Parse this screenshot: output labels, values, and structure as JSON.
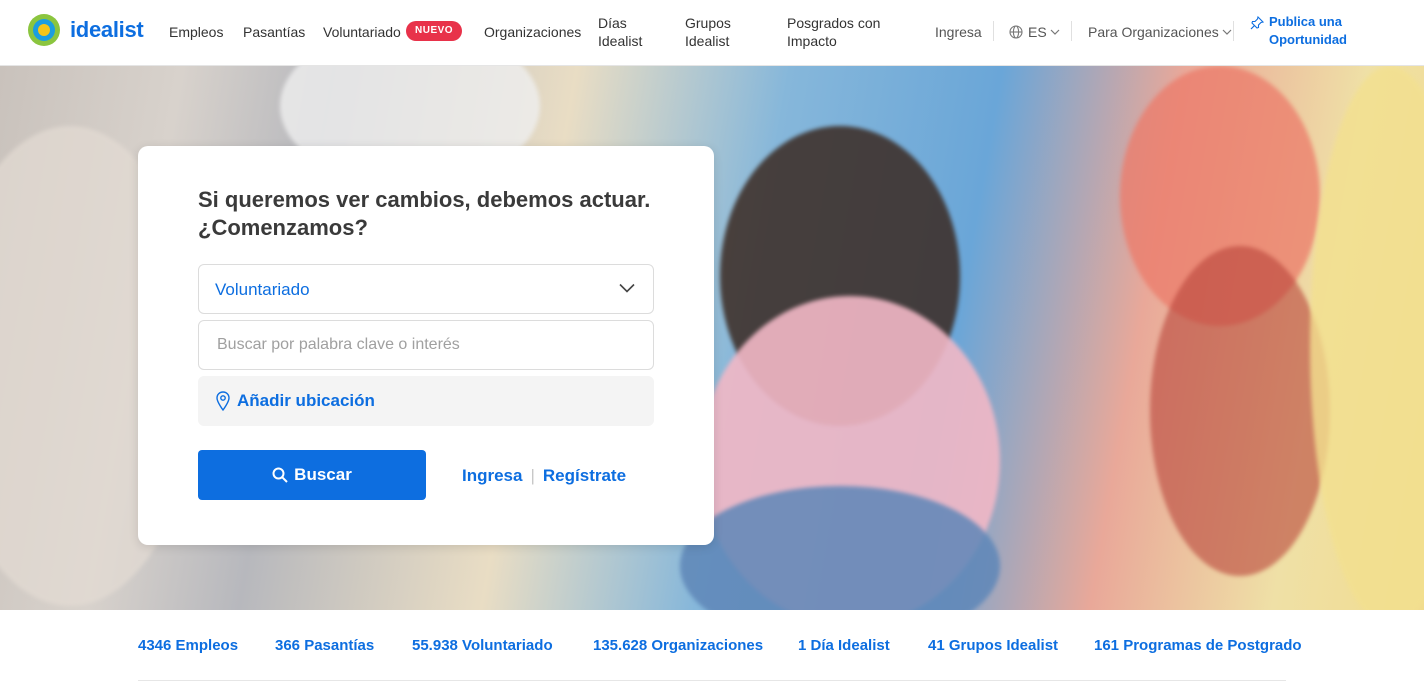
{
  "header": {
    "brand": "idealist",
    "nav": {
      "empleos": "Empleos",
      "pasantias": "Pasantías",
      "voluntariado": "Voluntariado",
      "nuevo_badge": "NUEVO",
      "organizaciones": "Organizaciones",
      "dias_line1": "Días",
      "dias_line2": "Idealist",
      "grupos_line1": "Grupos",
      "grupos_line2": "Idealist",
      "posgrados_line1": "Posgrados con",
      "posgrados_line2": "Impacto"
    },
    "ingresa": "Ingresa",
    "language": "ES",
    "para_org": "Para Organizaciones",
    "publish_line1": "Publica una",
    "publish_line2": "Oportunidad"
  },
  "search_card": {
    "title_line1": "Si queremos ver cambios, debemos actuar.",
    "title_line2": "¿Comenzamos?",
    "category_selected": "Voluntariado",
    "keyword_placeholder": "Buscar por palabra clave o interés",
    "location_label": "Añadir ubicación",
    "search_button": "Buscar",
    "login_link": "Ingresa",
    "register_link": "Regístrate"
  },
  "stats": [
    "4346 Empleos",
    "366 Pasantías",
    "55.938 Voluntariado",
    "135.628 Organizaciones",
    "1 Día Idealist",
    "41 Grupos Idealist",
    "161 Programas de Postgrado"
  ],
  "colors": {
    "brand_blue": "#0d6ee0",
    "badge_red": "#e8324a",
    "logo_green": "#8bc53f",
    "logo_yellow": "#f5c518"
  }
}
